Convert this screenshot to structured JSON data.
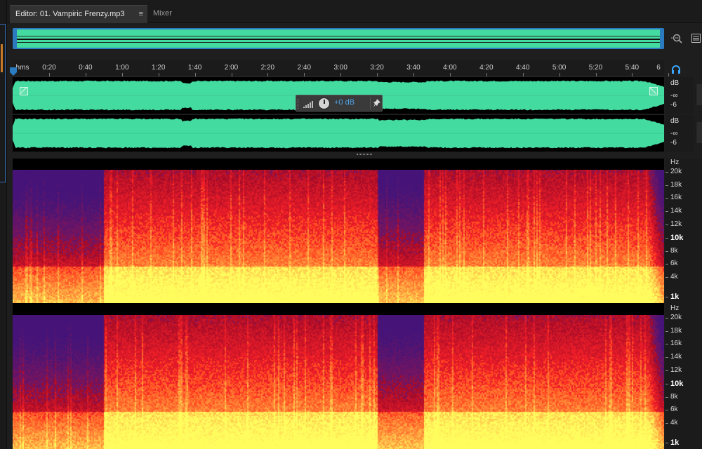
{
  "tabs": {
    "editor_label": "Editor: 01. Vampiric Frenzy.mp3",
    "editor_menu": "≡",
    "mixer_label": "Mixer"
  },
  "ruler": {
    "unit": "hms",
    "labels": [
      "0:20",
      "0:40",
      "1:00",
      "1:20",
      "1:40",
      "2:00",
      "2:20",
      "2:40",
      "3:00",
      "3:20",
      "3:40",
      "4:00",
      "4:20",
      "4:40",
      "5:00",
      "5:20",
      "5:40",
      "6"
    ]
  },
  "hud": {
    "gain": "+0 dB"
  },
  "db_scale": {
    "unit": "dB",
    "neg_inf": "-∞",
    "minus6": "-6"
  },
  "hz_scale": {
    "unit": "Hz",
    "labels": [
      "20k",
      "18k",
      "16k",
      "14k",
      "12k",
      "10k",
      "8k",
      "6k",
      "4k",
      "1k"
    ]
  },
  "colors": {
    "waveform": "#44dba0",
    "accent": "#2b7bc0",
    "gain_text": "#4ea3e6"
  },
  "icons": [
    "zoom-icon",
    "panel-menu-icon",
    "headphone-icon",
    "pin-icon",
    "level-meter-icon",
    "gain-knob-icon",
    "playhead-marker-icon",
    "fade-in-handle-icon",
    "fade-out-handle-icon"
  ]
}
